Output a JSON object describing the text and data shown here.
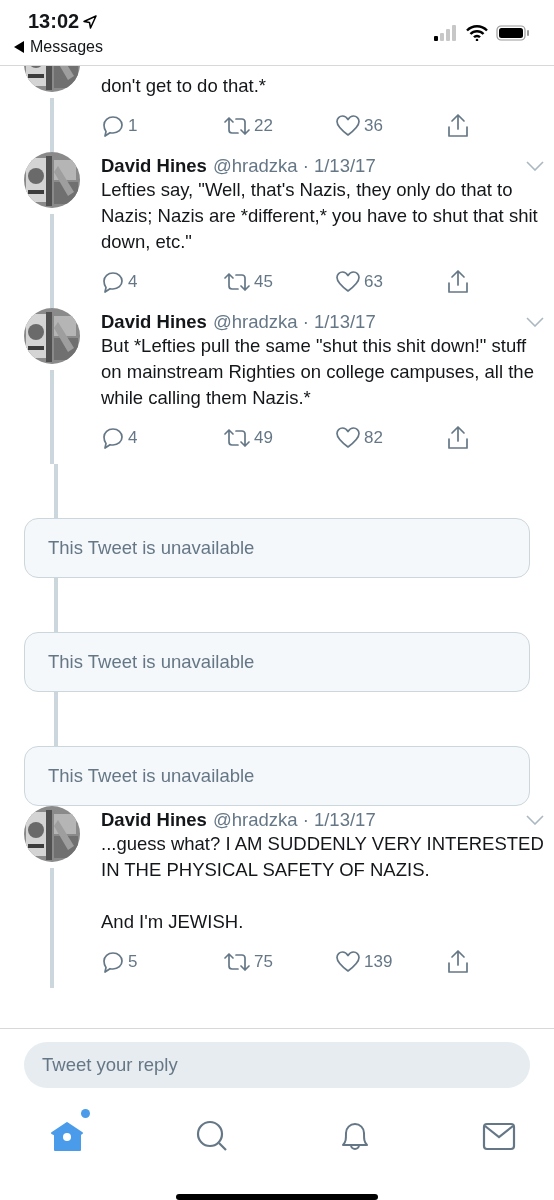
{
  "status_bar": {
    "time": "13:02",
    "back_label": "Messages"
  },
  "thread": [
    {
      "kind": "fragment",
      "text": "don't get to do that.*",
      "replies": "1",
      "retweets": "22",
      "likes": "36"
    },
    {
      "kind": "tweet",
      "name": "David Hines",
      "handle_date": "@hradzka · 1/13/17",
      "text": "Lefties say, \"Well, that's Nazis, they only do that to Nazis; Nazis are *different,* you have to shut that shit down, etc.\"",
      "replies": "4",
      "retweets": "45",
      "likes": "63"
    },
    {
      "kind": "tweet",
      "name": "David Hines",
      "handle_date": "@hradzka · 1/13/17",
      "text": "But *Lefties pull the same \"shut this shit down!\" stuff on mainstream Righties on college campuses, all the while calling them Nazis.*",
      "replies": "4",
      "retweets": "49",
      "likes": "82"
    },
    {
      "kind": "unavailable",
      "text": "This Tweet is unavailable"
    },
    {
      "kind": "unavailable",
      "text": "This Tweet is unavailable"
    },
    {
      "kind": "unavailable",
      "text": "This Tweet is unavailable"
    },
    {
      "kind": "tweet",
      "name": "David Hines",
      "handle_date": "@hradzka · 1/13/17",
      "text": "...guess what? I AM SUDDENLY VERY INTERESTED IN THE PHYSICAL SAFETY OF NAZIS.\n\nAnd I'm JEWISH.",
      "replies": "5",
      "retweets": "75",
      "likes": "139"
    }
  ],
  "reply_field": {
    "placeholder": "Tweet your reply"
  },
  "tabs": [
    {
      "kind": "home",
      "selected": true,
      "notification": true
    },
    {
      "kind": "search",
      "selected": false
    },
    {
      "kind": "notifications",
      "selected": false
    },
    {
      "kind": "messages",
      "selected": false
    }
  ]
}
